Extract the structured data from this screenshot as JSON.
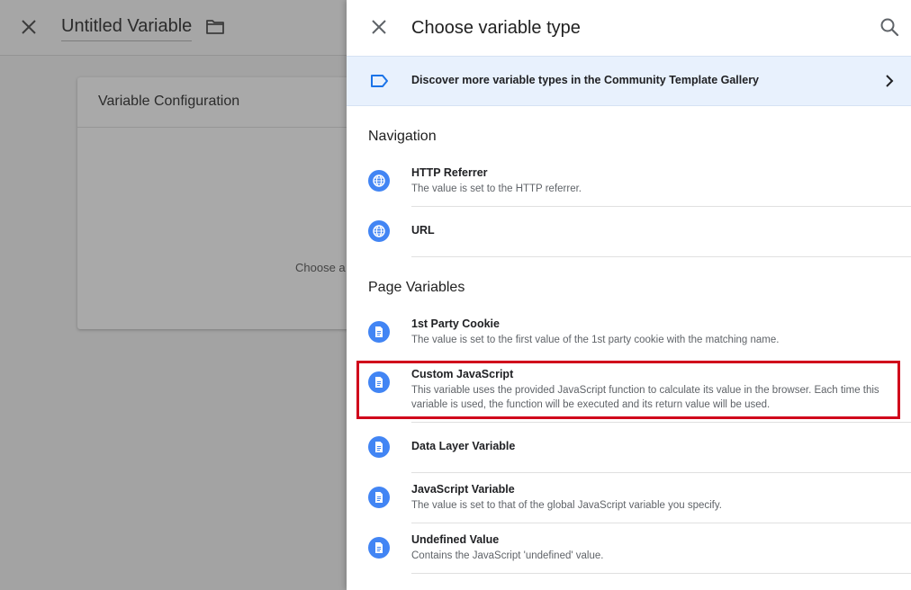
{
  "background": {
    "title": "Untitled Variable",
    "card_title": "Variable Configuration",
    "card_hint": "Choose a"
  },
  "drawer": {
    "title": "Choose variable type",
    "gallery_text": "Discover more variable types in the Community Template Gallery",
    "sections": [
      {
        "title": "Navigation",
        "items": [
          {
            "name": "HTTP Referrer",
            "desc": "The value is set to the HTTP referrer.",
            "icon": "globe-icon"
          },
          {
            "name": "URL",
            "desc": "",
            "icon": "globe-icon"
          }
        ]
      },
      {
        "title": "Page Variables",
        "items": [
          {
            "name": "1st Party Cookie",
            "desc": "The value is set to the first value of the 1st party cookie with the matching name.",
            "icon": "document-icon"
          },
          {
            "name": "Custom JavaScript",
            "desc": "This variable uses the provided JavaScript function to calculate its value in the browser. Each time this variable is used, the function will be executed and its return value will be used.",
            "icon": "document-icon"
          },
          {
            "name": "Data Layer Variable",
            "desc": "",
            "icon": "document-icon"
          },
          {
            "name": "JavaScript Variable",
            "desc": "The value is set to that of the global JavaScript variable you specify.",
            "icon": "document-icon"
          },
          {
            "name": "Undefined Value",
            "desc": "Contains the JavaScript 'undefined' value.",
            "icon": "document-icon"
          }
        ]
      }
    ]
  },
  "colors": {
    "accent": "#4285f4",
    "highlight": "#d0021b",
    "banner_bg": "#e8f1fd"
  }
}
